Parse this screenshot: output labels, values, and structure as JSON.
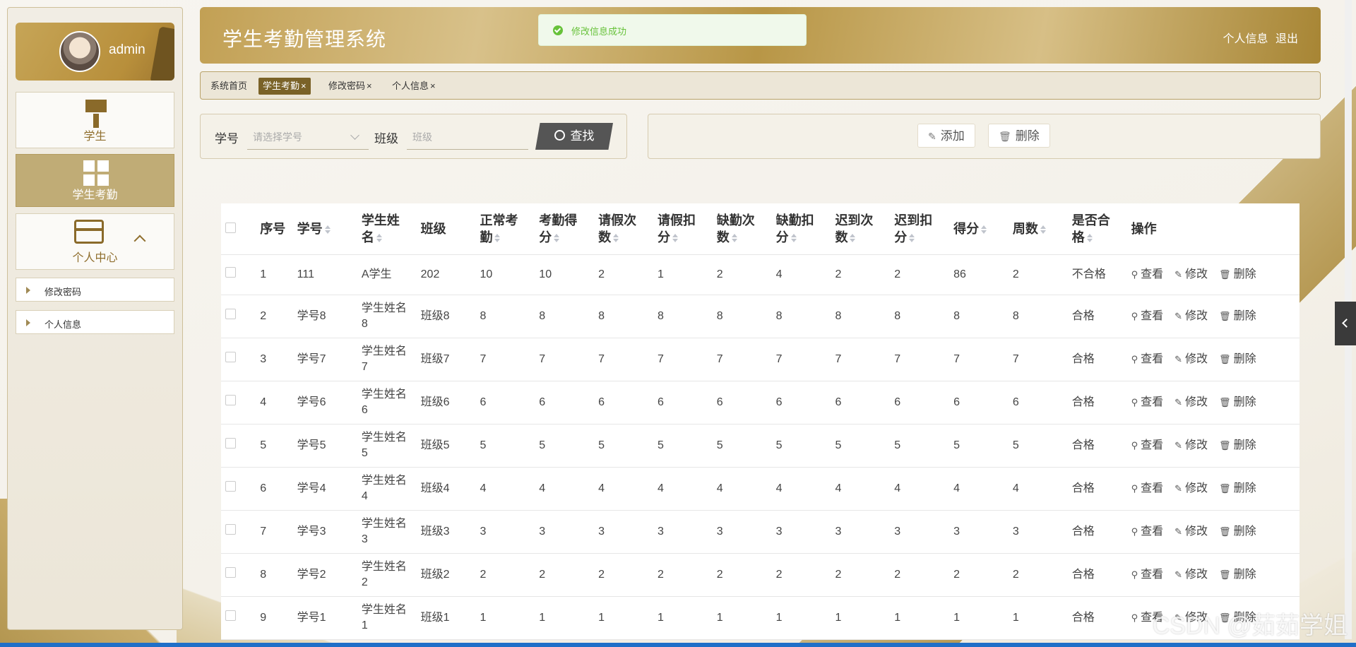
{
  "app": {
    "title": "学生考勤管理系统"
  },
  "header": {
    "profile_link": "个人信息",
    "logout_link": "退出"
  },
  "toast": {
    "message": "修改信息成功"
  },
  "user": {
    "name": "admin"
  },
  "sidebar": {
    "items": [
      {
        "label": "学生",
        "icon": "brush-icon"
      },
      {
        "label": "学生考勤",
        "icon": "grid-icon",
        "active": true
      },
      {
        "label": "个人中心",
        "icon": "card-icon"
      }
    ],
    "submenu": [
      "修改密码",
      "个人信息"
    ]
  },
  "tags": [
    {
      "label": "系统首页",
      "closable": false
    },
    {
      "label": "学生考勤",
      "closable": true,
      "active": true
    },
    {
      "label": "修改密码",
      "closable": true
    },
    {
      "label": "个人信息",
      "closable": true
    }
  ],
  "search": {
    "student_id_label": "学号",
    "student_id_placeholder": "请选择学号",
    "class_label": "班级",
    "class_placeholder": "班级",
    "search_button": "查找"
  },
  "actions": {
    "add_button": "添加",
    "delete_button": "删除"
  },
  "table": {
    "headers": [
      "序号",
      "学号",
      "学生姓名",
      "班级",
      "正常考勤",
      "考勤得分",
      "请假次数",
      "请假扣分",
      "缺勤次数",
      "缺勤扣分",
      "迟到次数",
      "迟到扣分",
      "得分",
      "周数",
      "是否合格",
      "操作"
    ],
    "row_actions": {
      "view": "查看",
      "edit": "修改",
      "delete": "删除"
    },
    "rows": [
      [
        "1",
        "111",
        "A学生",
        "202",
        "10",
        "10",
        "2",
        "1",
        "2",
        "4",
        "2",
        "2",
        "86",
        "2",
        "不合格"
      ],
      [
        "2",
        "学号8",
        "学生姓名8",
        "班级8",
        "8",
        "8",
        "8",
        "8",
        "8",
        "8",
        "8",
        "8",
        "8",
        "8",
        "合格"
      ],
      [
        "3",
        "学号7",
        "学生姓名7",
        "班级7",
        "7",
        "7",
        "7",
        "7",
        "7",
        "7",
        "7",
        "7",
        "7",
        "7",
        "合格"
      ],
      [
        "4",
        "学号6",
        "学生姓名6",
        "班级6",
        "6",
        "6",
        "6",
        "6",
        "6",
        "6",
        "6",
        "6",
        "6",
        "6",
        "合格"
      ],
      [
        "5",
        "学号5",
        "学生姓名5",
        "班级5",
        "5",
        "5",
        "5",
        "5",
        "5",
        "5",
        "5",
        "5",
        "5",
        "5",
        "合格"
      ],
      [
        "6",
        "学号4",
        "学生姓名4",
        "班级4",
        "4",
        "4",
        "4",
        "4",
        "4",
        "4",
        "4",
        "4",
        "4",
        "4",
        "合格"
      ],
      [
        "7",
        "学号3",
        "学生姓名3",
        "班级3",
        "3",
        "3",
        "3",
        "3",
        "3",
        "3",
        "3",
        "3",
        "3",
        "3",
        "合格"
      ],
      [
        "8",
        "学号2",
        "学生姓名2",
        "班级2",
        "2",
        "2",
        "2",
        "2",
        "2",
        "2",
        "2",
        "2",
        "2",
        "2",
        "合格"
      ],
      [
        "9",
        "学号1",
        "学生姓名1",
        "班级1",
        "1",
        "1",
        "1",
        "1",
        "1",
        "1",
        "1",
        "1",
        "1",
        "1",
        "合格"
      ]
    ]
  },
  "watermark": "CSDN @茹茹学姐",
  "colors": {
    "accent": "#b89646",
    "dark_tag": "#7a6228",
    "success": "#67c23a"
  }
}
